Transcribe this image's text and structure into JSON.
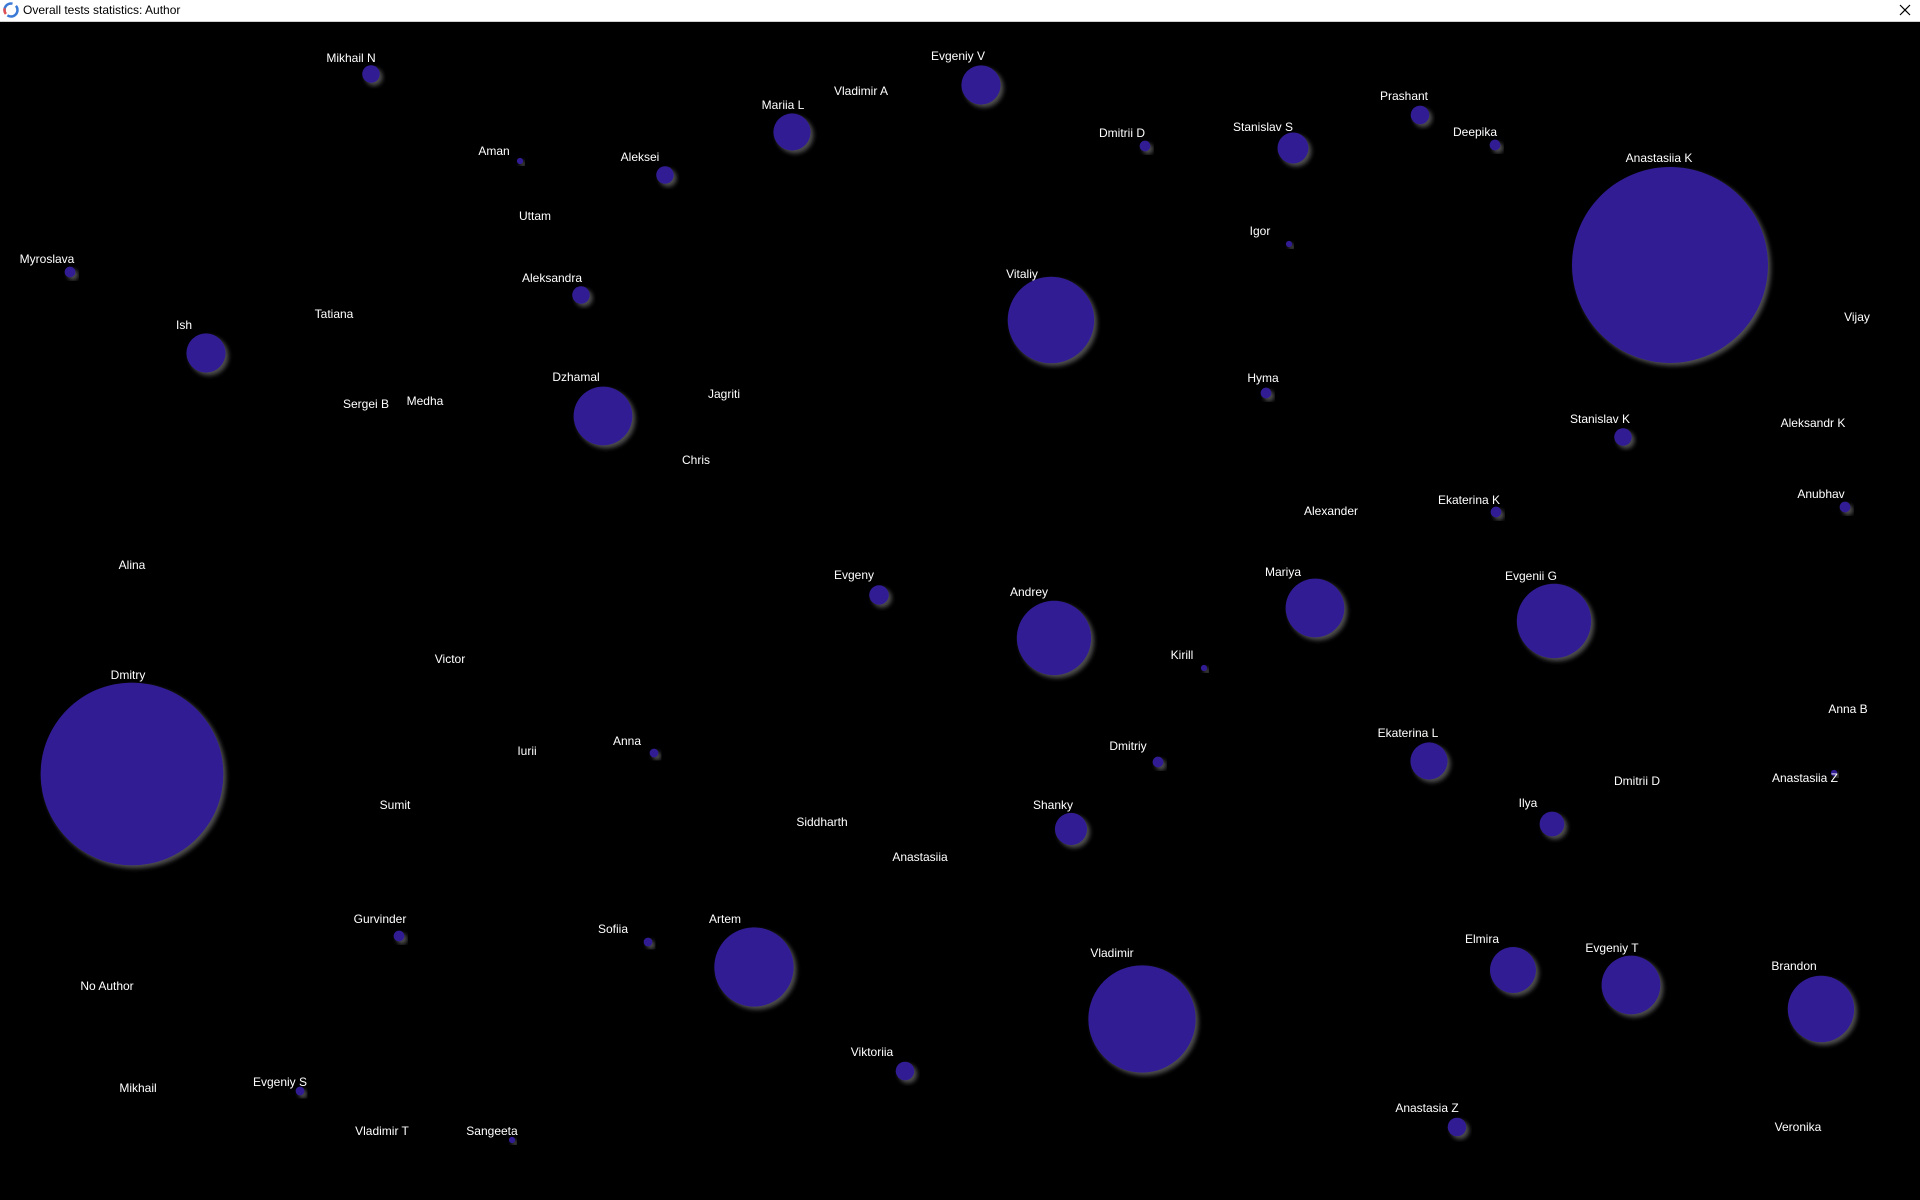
{
  "window": {
    "title": "Overall tests statistics: Author",
    "close_icon": "close-icon",
    "app_icon": "app-logo-icon"
  },
  "colors": {
    "background": "#000000",
    "bubble_fill": "#301a94",
    "bubble_shadow": "#555555",
    "label": "#ffffff"
  },
  "chart_data": {
    "type": "scatter",
    "title": "",
    "xlabel": "",
    "ylabel": "",
    "grid": false,
    "legend": "none",
    "series": [
      {
        "points": [
          {
            "label": "Mikhail N",
            "size": 8
          },
          {
            "label": "Evgeniy V",
            "size": 40
          },
          {
            "label": "Vladimir A",
            "size": 0
          },
          {
            "label": "Mariia L",
            "size": 36
          },
          {
            "label": "Prashant",
            "size": 9
          },
          {
            "label": "Aman",
            "size": 1
          },
          {
            "label": "Aleksei",
            "size": 8
          },
          {
            "label": "Dmitrii D",
            "size": 3
          },
          {
            "label": "Stanislav S",
            "size": 25
          },
          {
            "label": "Deepika",
            "size": 3
          },
          {
            "label": "Anastasiia K",
            "size": 1000
          },
          {
            "label": "Uttam",
            "size": 0
          },
          {
            "label": "Igor",
            "size": 1
          },
          {
            "label": "Myroslava",
            "size": 3
          },
          {
            "label": "Aleksandra",
            "size": 8
          },
          {
            "label": "Vitaliy",
            "size": 195
          },
          {
            "label": "Tatiana",
            "size": 0
          },
          {
            "label": "Ish",
            "size": 40
          },
          {
            "label": "Vijay",
            "size": 0
          },
          {
            "label": "Dzhamal",
            "size": 90
          },
          {
            "label": "Jagriti",
            "size": 0
          },
          {
            "label": "Hyma",
            "size": 3
          },
          {
            "label": "Sergei B",
            "size": 0
          },
          {
            "label": "Medha",
            "size": 0
          },
          {
            "label": "Stanislav K",
            "size": 8
          },
          {
            "label": "Aleksandr K",
            "size": 0
          },
          {
            "label": "Chris",
            "size": 0
          },
          {
            "label": "Anubhav",
            "size": 3
          },
          {
            "label": "Alexander",
            "size": 0
          },
          {
            "label": "Ekaterina K",
            "size": 3
          },
          {
            "label": "Alina",
            "size": 0
          },
          {
            "label": "Evgeny",
            "size": 10
          },
          {
            "label": "Mariya",
            "size": 90
          },
          {
            "label": "Evgenii G",
            "size": 144
          },
          {
            "label": "Andrey",
            "size": 144
          },
          {
            "label": "Kirill",
            "size": 1
          },
          {
            "label": "Dmitry",
            "size": 870
          },
          {
            "label": "Victor",
            "size": 0
          },
          {
            "label": "Anna B",
            "size": 0
          },
          {
            "label": "Ekaterina L",
            "size": 36
          },
          {
            "label": "Iurii",
            "size": 0
          },
          {
            "label": "Anna",
            "size": 2
          },
          {
            "label": "Dmitriy",
            "size": 3
          },
          {
            "label": "Anastasiia Z",
            "size": 1
          },
          {
            "label": "Dmitrii D",
            "size": 0
          },
          {
            "label": "Sumit",
            "size": 0
          },
          {
            "label": "Siddharth",
            "size": 0
          },
          {
            "label": "Shanky",
            "size": 27
          },
          {
            "label": "Ilya",
            "size": 16
          },
          {
            "label": "Anastasiia",
            "size": 0
          },
          {
            "label": "Gurvinder",
            "size": 3
          },
          {
            "label": "Sofiia",
            "size": 2
          },
          {
            "label": "Artem",
            "size": 164
          },
          {
            "label": "Vladimir",
            "size": 300
          },
          {
            "label": "Elmira",
            "size": 55
          },
          {
            "label": "Evgeniy T",
            "size": 90
          },
          {
            "label": "Brandon",
            "size": 115
          },
          {
            "label": "No Author",
            "size": 0
          },
          {
            "label": "Viktoriia",
            "size": 9
          },
          {
            "label": "Mikhail",
            "size": 0
          },
          {
            "label": "Evgeniy S",
            "size": 2
          },
          {
            "label": "Anastasia Z",
            "size": 9
          },
          {
            "label": "Vladimir T",
            "size": 0
          },
          {
            "label": "Sangeeta",
            "size": 1
          },
          {
            "label": "Veronika",
            "size": 0
          }
        ]
      }
    ]
  }
}
